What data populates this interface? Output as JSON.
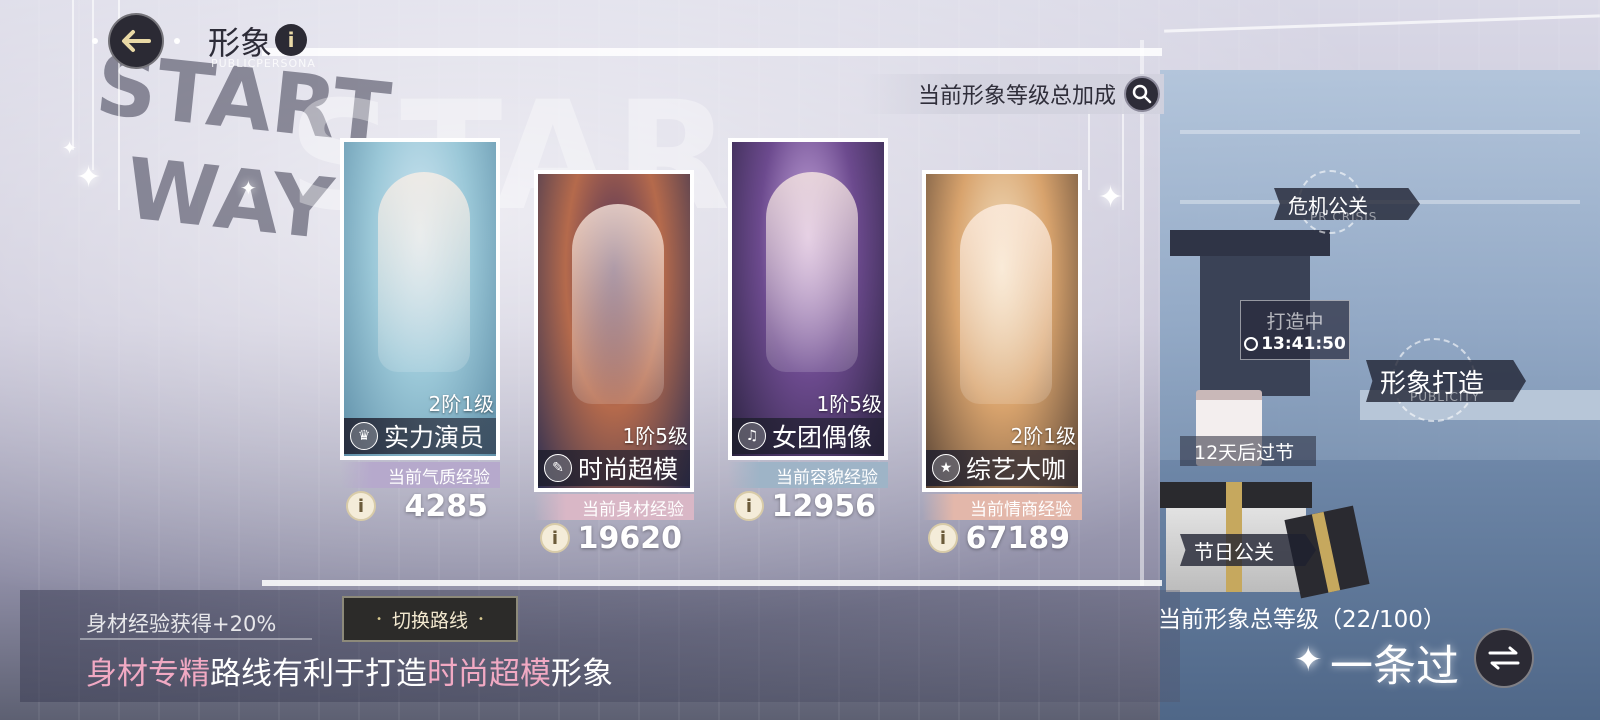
{
  "header": {
    "title": "形象",
    "subtitle": "PUBLICPERSONA",
    "back_icon": "arrow-left-icon",
    "info_label": "i"
  },
  "background_text": {
    "left_top": "START",
    "left_bottom": "WAY",
    "center": "STAR"
  },
  "level_bonus": {
    "label": "当前形象等级总加成"
  },
  "cards": [
    {
      "tier": "2阶1级",
      "name": "实力演员",
      "stat_label": "当前气质经验",
      "stat_value": "4285",
      "label_color": "#b6a9cc",
      "palette": [
        "#cfe6f2",
        "#9bc8d8",
        "#5f8fa8"
      ]
    },
    {
      "tier": "1阶5级",
      "name": "时尚超模",
      "stat_label": "当前身材经验",
      "stat_value": "19620",
      "label_color": "#d9b7c6",
      "palette": [
        "#4b2f57",
        "#b56a4c",
        "#2d2f52"
      ]
    },
    {
      "tier": "1阶5级",
      "name": "女团偶像",
      "stat_label": "当前容貌经验",
      "stat_value": "12956",
      "label_color": "#9eb4c7",
      "palette": [
        "#c7a8df",
        "#6c4a8e",
        "#2b2340"
      ]
    },
    {
      "tier": "2阶1级",
      "name": "综艺大咖",
      "stat_label": "当前情商经验",
      "stat_value": "67189",
      "label_color": "#e3b7aa",
      "palette": [
        "#f3e2c4",
        "#d8a36d",
        "#5a4536"
      ]
    }
  ],
  "info_label": "i",
  "side_tags": {
    "crisis": {
      "label": "危机公关",
      "sub": "PR CRISIS"
    },
    "build": {
      "label": "形象打造",
      "sub": "PUBLICITY"
    },
    "festival": {
      "label": "节日公关"
    }
  },
  "timer": {
    "status": "打造中",
    "time": "13:41:50"
  },
  "festival_countdown": "12天后过节",
  "bottom": {
    "switch_label": "切换路线",
    "bonus": "身材经验获得+20%",
    "route_part1": "身材专精",
    "route_part2": "路线有利于打造",
    "route_part3": "时尚超模",
    "route_part4": "形象"
  },
  "total_level": "当前形象总等级（22/100）",
  "persona_name": "一条过"
}
